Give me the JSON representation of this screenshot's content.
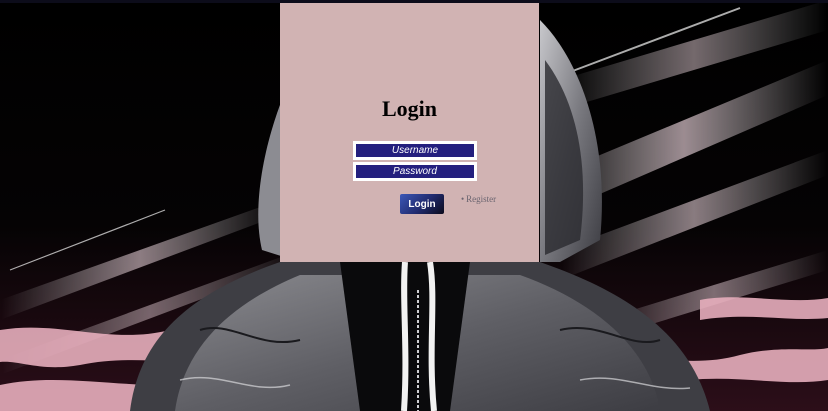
{
  "page": {
    "background": "hooded figure illustration with diagonal light streaks"
  },
  "login": {
    "title": "Login",
    "username_placeholder": "Username",
    "password_placeholder": "Password",
    "login_button_label": "Login",
    "register_bullet": "•",
    "register_label": "Register"
  },
  "colors": {
    "card_background": "#d1b3b3",
    "field_background": "#241f7e",
    "field_border": "#ffffff",
    "button_gradient_start": "#3b58b8",
    "button_gradient_end": "#0b0b1b",
    "register_text": "#6b6570",
    "pink_accent": "#e7aebd"
  }
}
